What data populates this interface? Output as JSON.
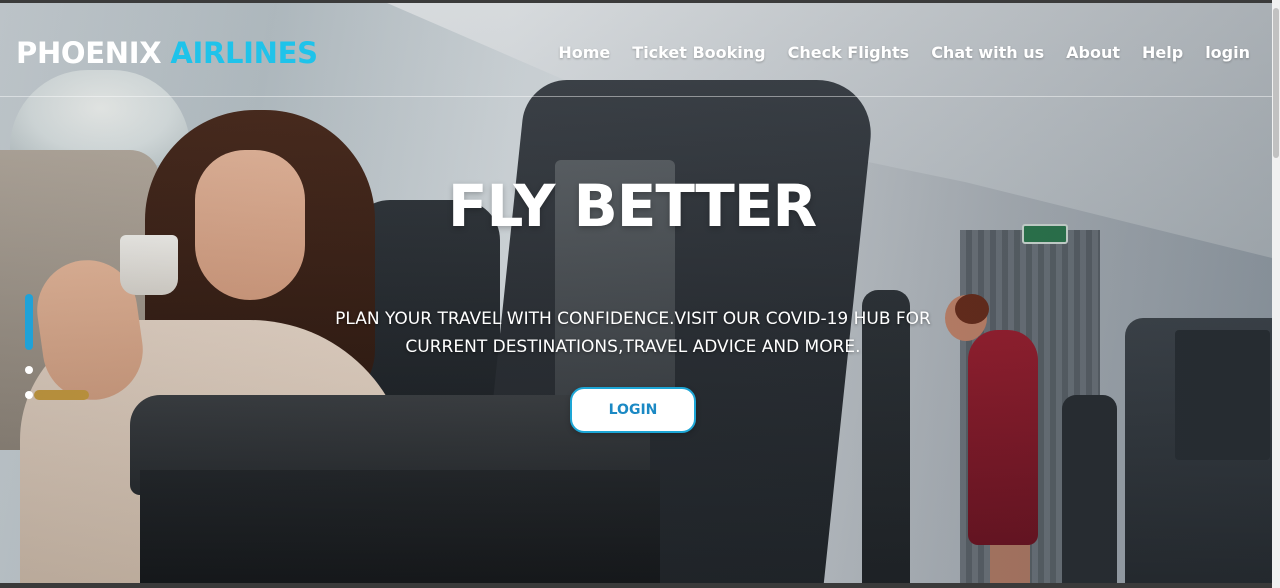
{
  "brand": {
    "part1": "PHOENIX",
    "part2": "AIRLINES",
    "accent_color": "#1fc3ea"
  },
  "nav": {
    "items": [
      {
        "label": "Home"
      },
      {
        "label": "Ticket Booking"
      },
      {
        "label": "Check Flights"
      },
      {
        "label": "Chat with us"
      },
      {
        "label": "About"
      },
      {
        "label": "Help"
      },
      {
        "label": "login"
      }
    ]
  },
  "hero": {
    "title": "FLY BETTER",
    "subtitle_line1": "PLAN YOUR TRAVEL WITH CONFIDENCE.VISIT OUR COVID-19 HUB FOR",
    "subtitle_line2": "CURRENT DESTINATIONS,TRAVEL ADVICE AND MORE.",
    "cta_label": "LOGIN"
  },
  "carousel": {
    "slides": 3,
    "active_slide": 1,
    "active_color": "#1fa2d8"
  }
}
